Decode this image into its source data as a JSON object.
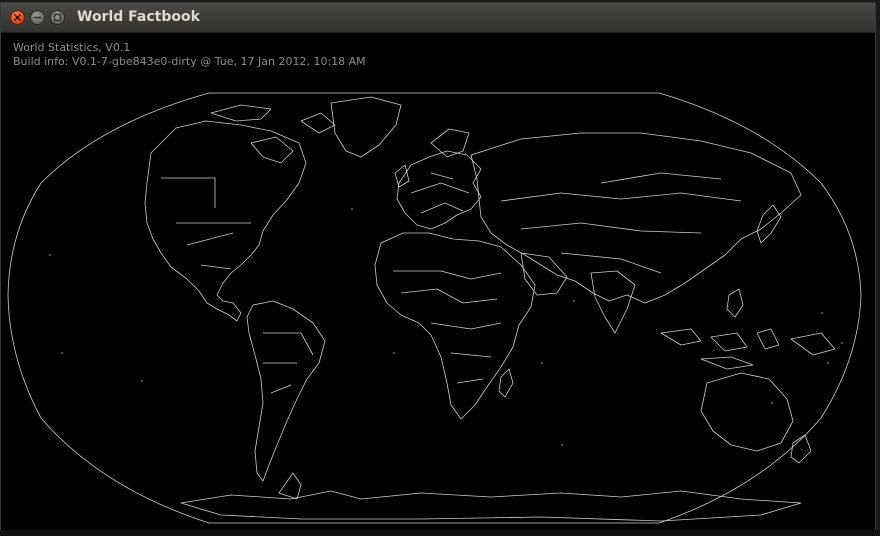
{
  "window": {
    "title": "World Factbook",
    "controls": [
      "close-icon",
      "minimize-icon",
      "maximize-icon"
    ],
    "colors": {
      "titlebar": "#3c3b37",
      "close": "#df4a16",
      "background": "#000000",
      "map_lines": "#cfcfcf"
    }
  },
  "content": {
    "info_line1": "World Statistics, V0.1",
    "info_line2": "Build info: V0.1-7-gbe843e0-dirty @ Tue, 17 Jan 2012, 10:18 AM"
  },
  "map": {
    "projection": "Robinson",
    "content": "world country borders"
  }
}
